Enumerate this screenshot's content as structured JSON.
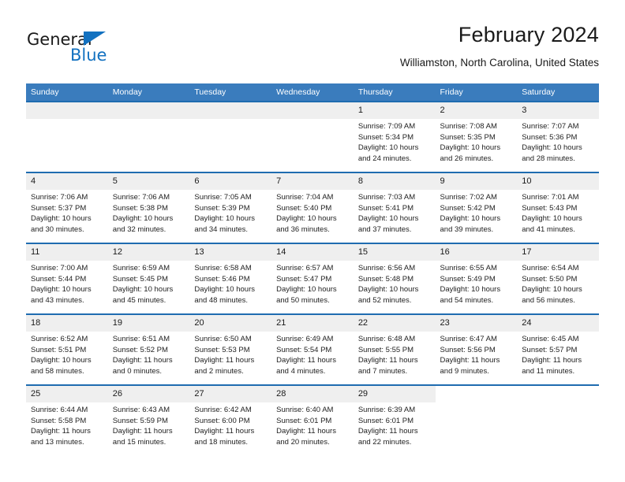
{
  "brand": {
    "name_part1": "General",
    "name_part2": "Blue",
    "accent_color": "#1271c0"
  },
  "header": {
    "month_title": "February 2024",
    "location": "Williamston, North Carolina, United States"
  },
  "colors": {
    "header_band": "#3a7cbd",
    "week_separator": "#1f6cb0",
    "daynum_band": "#efefef"
  },
  "weekday_headers": [
    "Sunday",
    "Monday",
    "Tuesday",
    "Wednesday",
    "Thursday",
    "Friday",
    "Saturday"
  ],
  "weeks": [
    [
      {
        "day": "",
        "sunrise": "",
        "sunset": "",
        "daylight": "",
        "blank": true
      },
      {
        "day": "",
        "sunrise": "",
        "sunset": "",
        "daylight": "",
        "blank": true
      },
      {
        "day": "",
        "sunrise": "",
        "sunset": "",
        "daylight": "",
        "blank": true
      },
      {
        "day": "",
        "sunrise": "",
        "sunset": "",
        "daylight": "",
        "blank": true
      },
      {
        "day": "1",
        "sunrise": "Sunrise: 7:09 AM",
        "sunset": "Sunset: 5:34 PM",
        "daylight": "Daylight: 10 hours and 24 minutes."
      },
      {
        "day": "2",
        "sunrise": "Sunrise: 7:08 AM",
        "sunset": "Sunset: 5:35 PM",
        "daylight": "Daylight: 10 hours and 26 minutes."
      },
      {
        "day": "3",
        "sunrise": "Sunrise: 7:07 AM",
        "sunset": "Sunset: 5:36 PM",
        "daylight": "Daylight: 10 hours and 28 minutes."
      }
    ],
    [
      {
        "day": "4",
        "sunrise": "Sunrise: 7:06 AM",
        "sunset": "Sunset: 5:37 PM",
        "daylight": "Daylight: 10 hours and 30 minutes."
      },
      {
        "day": "5",
        "sunrise": "Sunrise: 7:06 AM",
        "sunset": "Sunset: 5:38 PM",
        "daylight": "Daylight: 10 hours and 32 minutes."
      },
      {
        "day": "6",
        "sunrise": "Sunrise: 7:05 AM",
        "sunset": "Sunset: 5:39 PM",
        "daylight": "Daylight: 10 hours and 34 minutes."
      },
      {
        "day": "7",
        "sunrise": "Sunrise: 7:04 AM",
        "sunset": "Sunset: 5:40 PM",
        "daylight": "Daylight: 10 hours and 36 minutes."
      },
      {
        "day": "8",
        "sunrise": "Sunrise: 7:03 AM",
        "sunset": "Sunset: 5:41 PM",
        "daylight": "Daylight: 10 hours and 37 minutes."
      },
      {
        "day": "9",
        "sunrise": "Sunrise: 7:02 AM",
        "sunset": "Sunset: 5:42 PM",
        "daylight": "Daylight: 10 hours and 39 minutes."
      },
      {
        "day": "10",
        "sunrise": "Sunrise: 7:01 AM",
        "sunset": "Sunset: 5:43 PM",
        "daylight": "Daylight: 10 hours and 41 minutes."
      }
    ],
    [
      {
        "day": "11",
        "sunrise": "Sunrise: 7:00 AM",
        "sunset": "Sunset: 5:44 PM",
        "daylight": "Daylight: 10 hours and 43 minutes."
      },
      {
        "day": "12",
        "sunrise": "Sunrise: 6:59 AM",
        "sunset": "Sunset: 5:45 PM",
        "daylight": "Daylight: 10 hours and 45 minutes."
      },
      {
        "day": "13",
        "sunrise": "Sunrise: 6:58 AM",
        "sunset": "Sunset: 5:46 PM",
        "daylight": "Daylight: 10 hours and 48 minutes."
      },
      {
        "day": "14",
        "sunrise": "Sunrise: 6:57 AM",
        "sunset": "Sunset: 5:47 PM",
        "daylight": "Daylight: 10 hours and 50 minutes."
      },
      {
        "day": "15",
        "sunrise": "Sunrise: 6:56 AM",
        "sunset": "Sunset: 5:48 PM",
        "daylight": "Daylight: 10 hours and 52 minutes."
      },
      {
        "day": "16",
        "sunrise": "Sunrise: 6:55 AM",
        "sunset": "Sunset: 5:49 PM",
        "daylight": "Daylight: 10 hours and 54 minutes."
      },
      {
        "day": "17",
        "sunrise": "Sunrise: 6:54 AM",
        "sunset": "Sunset: 5:50 PM",
        "daylight": "Daylight: 10 hours and 56 minutes."
      }
    ],
    [
      {
        "day": "18",
        "sunrise": "Sunrise: 6:52 AM",
        "sunset": "Sunset: 5:51 PM",
        "daylight": "Daylight: 10 hours and 58 minutes."
      },
      {
        "day": "19",
        "sunrise": "Sunrise: 6:51 AM",
        "sunset": "Sunset: 5:52 PM",
        "daylight": "Daylight: 11 hours and 0 minutes."
      },
      {
        "day": "20",
        "sunrise": "Sunrise: 6:50 AM",
        "sunset": "Sunset: 5:53 PM",
        "daylight": "Daylight: 11 hours and 2 minutes."
      },
      {
        "day": "21",
        "sunrise": "Sunrise: 6:49 AM",
        "sunset": "Sunset: 5:54 PM",
        "daylight": "Daylight: 11 hours and 4 minutes."
      },
      {
        "day": "22",
        "sunrise": "Sunrise: 6:48 AM",
        "sunset": "Sunset: 5:55 PM",
        "daylight": "Daylight: 11 hours and 7 minutes."
      },
      {
        "day": "23",
        "sunrise": "Sunrise: 6:47 AM",
        "sunset": "Sunset: 5:56 PM",
        "daylight": "Daylight: 11 hours and 9 minutes."
      },
      {
        "day": "24",
        "sunrise": "Sunrise: 6:45 AM",
        "sunset": "Sunset: 5:57 PM",
        "daylight": "Daylight: 11 hours and 11 minutes."
      }
    ],
    [
      {
        "day": "25",
        "sunrise": "Sunrise: 6:44 AM",
        "sunset": "Sunset: 5:58 PM",
        "daylight": "Daylight: 11 hours and 13 minutes."
      },
      {
        "day": "26",
        "sunrise": "Sunrise: 6:43 AM",
        "sunset": "Sunset: 5:59 PM",
        "daylight": "Daylight: 11 hours and 15 minutes."
      },
      {
        "day": "27",
        "sunrise": "Sunrise: 6:42 AM",
        "sunset": "Sunset: 6:00 PM",
        "daylight": "Daylight: 11 hours and 18 minutes."
      },
      {
        "day": "28",
        "sunrise": "Sunrise: 6:40 AM",
        "sunset": "Sunset: 6:01 PM",
        "daylight": "Daylight: 11 hours and 20 minutes."
      },
      {
        "day": "29",
        "sunrise": "Sunrise: 6:39 AM",
        "sunset": "Sunset: 6:01 PM",
        "daylight": "Daylight: 11 hours and 22 minutes."
      },
      {
        "day": "",
        "sunrise": "",
        "sunset": "",
        "daylight": "",
        "blank": true,
        "nogray": true
      },
      {
        "day": "",
        "sunrise": "",
        "sunset": "",
        "daylight": "",
        "blank": true,
        "nogray": true
      }
    ]
  ]
}
